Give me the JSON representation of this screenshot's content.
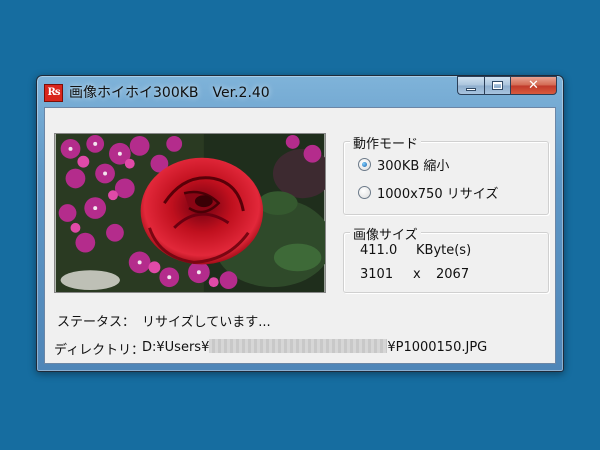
{
  "window": {
    "icon_text": "Rs",
    "title": "画像ホイホイ300KB　Ver.2.40",
    "close_glyph": "✕"
  },
  "mode": {
    "legend": "動作モード",
    "options": [
      {
        "label": "300KB 縮小",
        "checked": true
      },
      {
        "label": "1000x750 リサイズ",
        "checked": false
      }
    ]
  },
  "image_size": {
    "legend": "画像サイズ",
    "file_size": "411.0",
    "file_size_unit": "KByte(s)",
    "width": "3101",
    "times": "x",
    "height": "2067"
  },
  "status": {
    "label": "ステータス：",
    "value": "リサイズしています..."
  },
  "directory": {
    "label": "ディレクトリ：",
    "path_prefix": "D:¥Users¥",
    "path_suffix": "¥P1000150.JPG"
  },
  "colors": {
    "desktop": "#166da0",
    "close_button": "#c0392a",
    "radio_selected": "#1a5da8"
  }
}
